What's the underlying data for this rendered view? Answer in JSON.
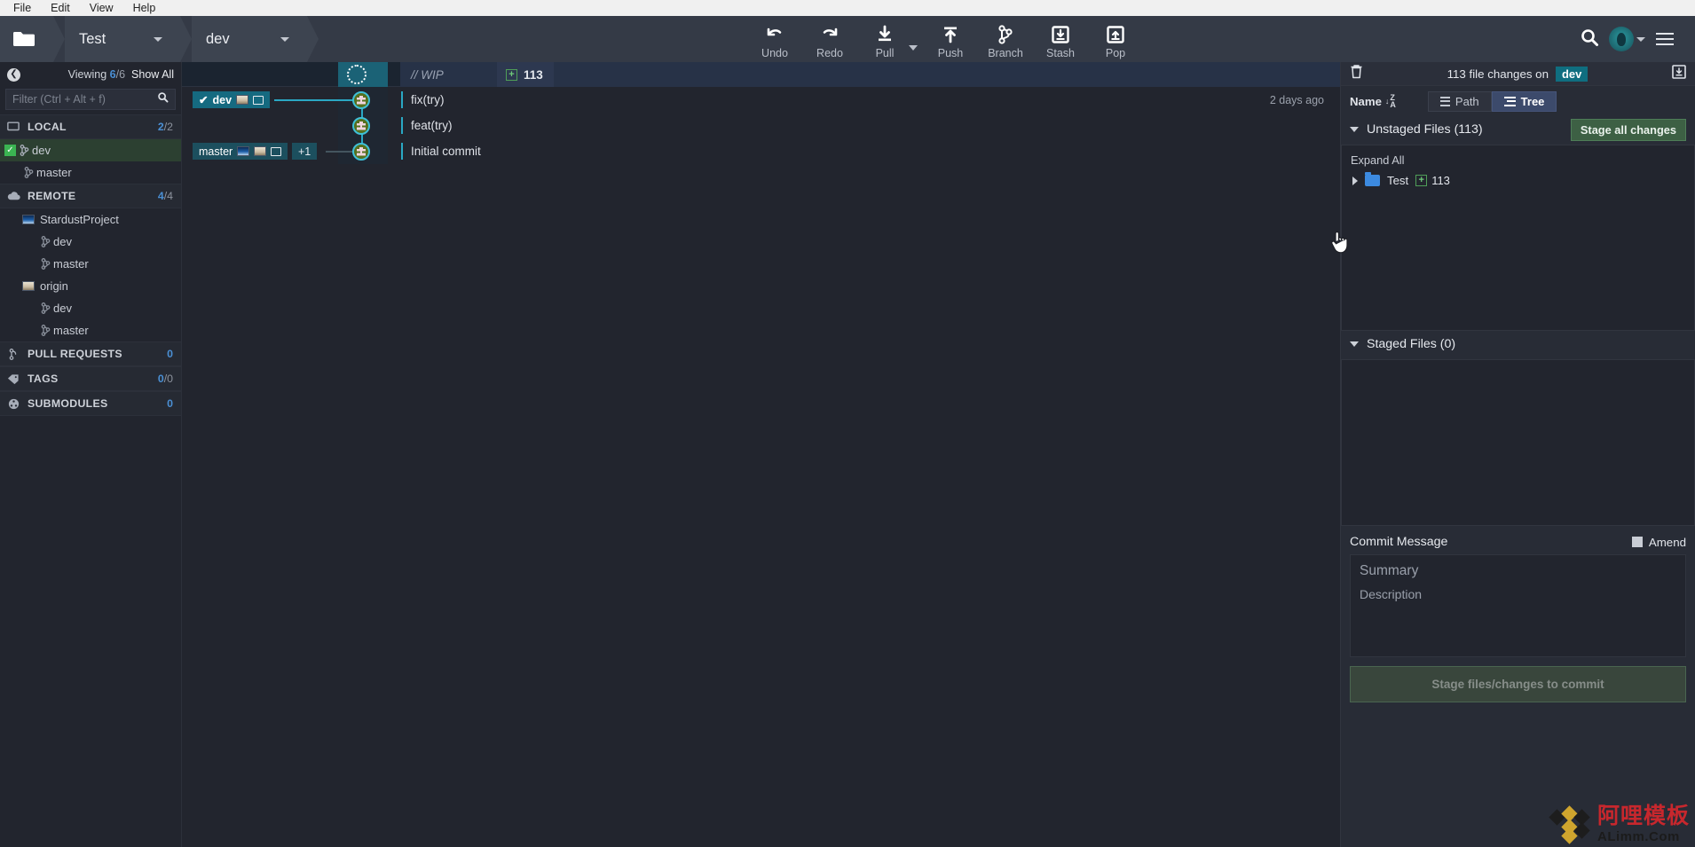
{
  "menubar": {
    "items": [
      "File",
      "Edit",
      "View",
      "Help"
    ]
  },
  "toolbar": {
    "folder_icon": "folder-icon",
    "repo_name": "Test",
    "branch_name": "dev",
    "actions": [
      {
        "id": "undo",
        "label": "Undo",
        "icon": "undo-arrow-icon"
      },
      {
        "id": "redo",
        "label": "Redo",
        "icon": "redo-arrow-icon"
      },
      {
        "id": "pull",
        "label": "Pull",
        "icon": "pull-download-icon"
      },
      {
        "id": "push",
        "label": "Push",
        "icon": "push-upload-icon"
      },
      {
        "id": "branch",
        "label": "Branch",
        "icon": "branch-icon"
      },
      {
        "id": "stash",
        "label": "Stash",
        "icon": "stash-down-icon"
      },
      {
        "id": "pop",
        "label": "Pop",
        "icon": "stash-pop-icon"
      }
    ],
    "search_icon": "search-icon",
    "avatar_icon": "avatar-icon",
    "menu_icon": "hamburger-menu-icon"
  },
  "sidebar": {
    "back_icon": "back-chevron-icon",
    "viewing_label": "Viewing",
    "viewing_current": "6",
    "viewing_total": "/6",
    "show_all": "Show All",
    "filter_placeholder": "Filter (Ctrl + Alt + f)",
    "filter_value": "",
    "sections": [
      {
        "id": "local",
        "label": "LOCAL",
        "icon": "monitor-icon",
        "count_current": "2",
        "count_total": "/2",
        "rows": [
          {
            "label": "dev",
            "icon": "branch-icon",
            "selected": true,
            "checked": true,
            "indent": 1
          },
          {
            "label": "master",
            "icon": "branch-icon",
            "selected": false,
            "checked": false,
            "indent": 1
          }
        ]
      },
      {
        "id": "remote",
        "label": "REMOTE",
        "icon": "cloud-icon",
        "count_current": "4",
        "count_total": "/4",
        "rows": [
          {
            "label": "StardustProject",
            "icon": "remote-thumb-blue-icon",
            "indent": 1
          },
          {
            "label": "dev",
            "icon": "branch-icon",
            "indent": 2
          },
          {
            "label": "master",
            "icon": "branch-icon",
            "indent": 2
          },
          {
            "label": "origin",
            "icon": "remote-thumb-beige-icon",
            "indent": 1
          },
          {
            "label": "dev",
            "icon": "branch-icon",
            "indent": 2
          },
          {
            "label": "master",
            "icon": "branch-icon",
            "indent": 2
          }
        ]
      },
      {
        "id": "pull-requests",
        "label": "PULL REQUESTS",
        "icon": "pull-request-icon",
        "count_current": "0",
        "count_total": "",
        "rows": []
      },
      {
        "id": "tags",
        "label": "TAGS",
        "icon": "tag-icon",
        "count_current": "0",
        "count_total": "/0",
        "rows": []
      },
      {
        "id": "submodules",
        "label": "SUBMODULES",
        "icon": "submodule-icon",
        "count_current": "0",
        "count_total": "",
        "rows": []
      }
    ]
  },
  "graph": {
    "wip": {
      "message": "// WIP",
      "change_count": "113",
      "plus_glyph": "+"
    },
    "rows": [
      {
        "message": "fix(try)",
        "time": "2 days ago",
        "chip": {
          "label": "dev",
          "check": "✔",
          "icons": [
            "avatar-thumb-icon",
            "monitor-icon"
          ],
          "plus": ""
        }
      },
      {
        "message": "feat(try)",
        "time": "",
        "chip": null
      },
      {
        "message": "Initial commit",
        "time": "",
        "chip": {
          "label": "master",
          "check": "",
          "icons": [
            "remote-thumb-blue-icon",
            "remote-thumb-beige-icon",
            "monitor-icon"
          ],
          "plus": "+1"
        }
      }
    ]
  },
  "right_panel": {
    "trash_icon": "trash-icon",
    "header_title": "113 file changes on",
    "header_branch": "dev",
    "collapse_icon": "collapse-panel-icon",
    "sort_label": "Name",
    "sort_dir_icon": "sort-az-descending-icon",
    "view_modes": [
      {
        "id": "path",
        "label": "Path",
        "icon": "list-icon",
        "active": false
      },
      {
        "id": "tree",
        "label": "Tree",
        "icon": "tree-icon",
        "active": true
      }
    ],
    "unstaged": {
      "title": "Unstaged Files (113)",
      "stage_all_label": "Stage all changes",
      "expand_all_label": "Expand All",
      "tree_rows": [
        {
          "name": "Test",
          "count": "113",
          "plus_glyph": "+",
          "icon": "folder-icon"
        }
      ]
    },
    "staged": {
      "title": "Staged Files (0)"
    },
    "commit": {
      "title": "Commit Message",
      "amend_label": "Amend",
      "amend_checked": false,
      "summary_placeholder": "Summary",
      "description_placeholder": "Description",
      "summary_value": "",
      "description_value": "",
      "button_label": "Stage files/changes to commit"
    }
  },
  "watermark": {
    "cn": "阿哩模板",
    "en": "ALimm.Com"
  },
  "colors": {
    "accent_teal": "#2aa8c4",
    "branch_pill": "#0f6e80",
    "green_check": "#3bb552",
    "blue_count": "#4a8fd4",
    "bg_dark": "#22252e",
    "toolbar_bg": "#343a46"
  }
}
